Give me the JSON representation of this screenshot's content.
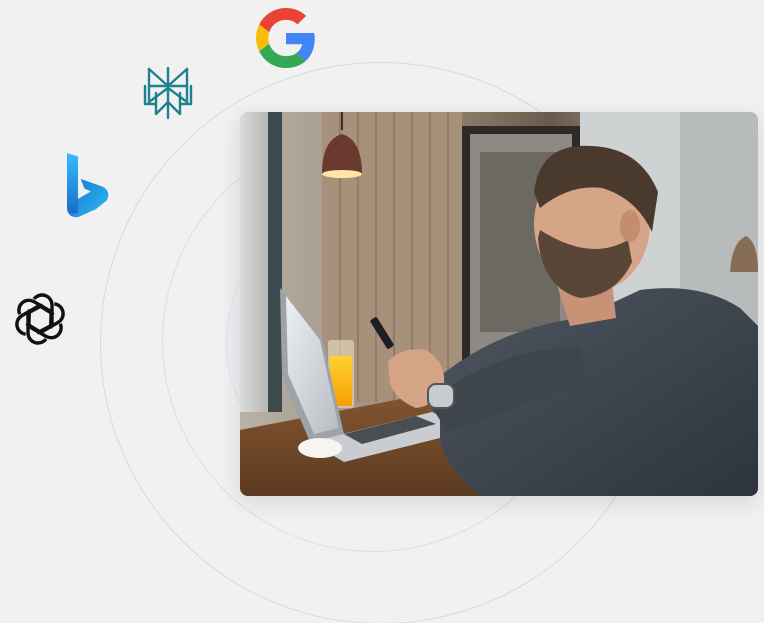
{
  "logos": {
    "google": "google-logo",
    "perplexity": "perplexity-logo",
    "bing": "bing-logo",
    "openai": "openai-logo"
  },
  "photo": {
    "subject": "man-using-phone-with-laptop-in-cafe"
  },
  "colors": {
    "background": "#f1f1f2",
    "ring": "#d7d9de",
    "google_blue": "#4285F4",
    "google_red": "#EA4335",
    "google_yellow": "#FBBC05",
    "google_green": "#34A853",
    "perplexity_teal": "#20808D",
    "bing_blue": "#1B73D3",
    "openai_black": "#111111"
  }
}
